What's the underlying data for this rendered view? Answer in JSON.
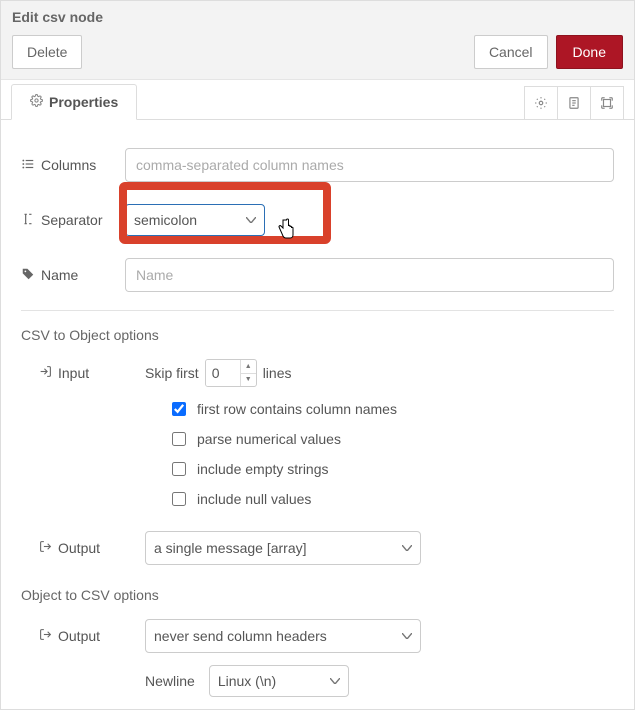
{
  "header": {
    "title": "Edit csv node",
    "delete": "Delete",
    "cancel": "Cancel",
    "done": "Done"
  },
  "tabs": {
    "properties": "Properties"
  },
  "fields": {
    "columns_label": "Columns",
    "columns_placeholder": "comma-separated column names",
    "columns_value": "",
    "separator_label": "Separator",
    "separator_value": "semicolon",
    "name_label": "Name",
    "name_placeholder": "Name",
    "name_value": ""
  },
  "csv2obj": {
    "title": "CSV to Object options",
    "input_label": "Input",
    "skip_first_pre": "Skip first",
    "skip_first_value": "0",
    "skip_first_post": "lines",
    "first_row_label": "first row contains column names",
    "first_row_checked": true,
    "parse_num_label": "parse numerical values",
    "parse_num_checked": false,
    "include_empty_label": "include empty strings",
    "include_empty_checked": false,
    "include_null_label": "include null values",
    "include_null_checked": false,
    "output_label": "Output",
    "output_value": "a single message [array]"
  },
  "obj2csv": {
    "title": "Object to CSV options",
    "output_label": "Output",
    "output_value": "never send column headers",
    "newline_label": "Newline",
    "newline_value": "Linux (\\n)"
  }
}
